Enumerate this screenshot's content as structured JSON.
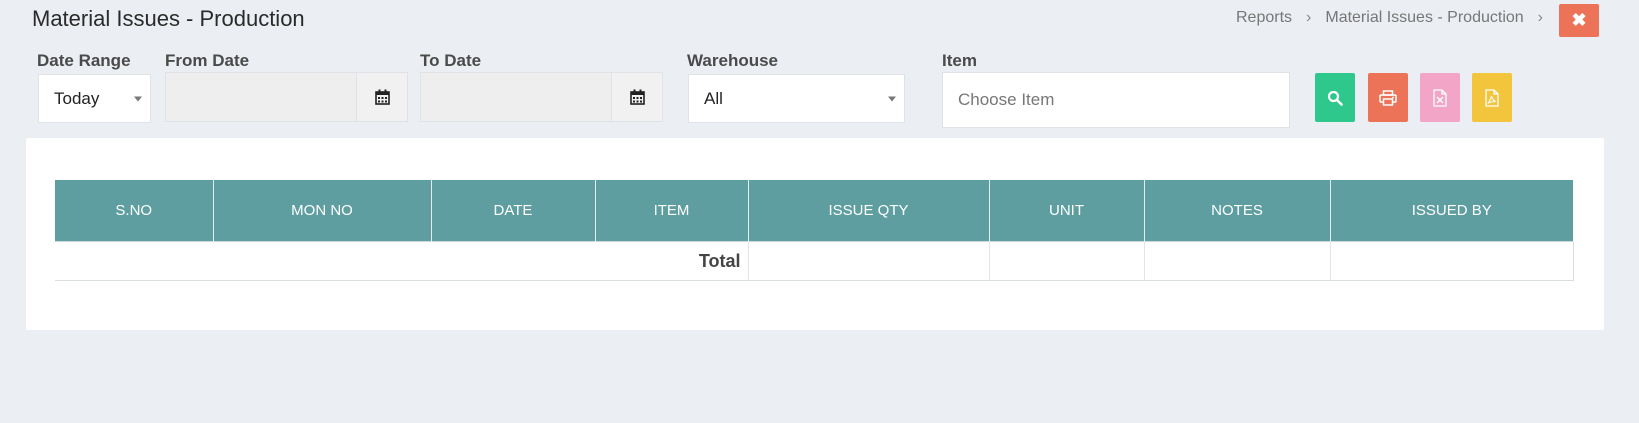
{
  "header": {
    "title": "Material Issues - Production",
    "breadcrumb": [
      "Reports",
      "Material Issues - Production"
    ],
    "close_icon": "close-icon"
  },
  "filters": {
    "date_range": {
      "label": "Date Range",
      "value": "Today"
    },
    "from_date": {
      "label": "From Date",
      "value": ""
    },
    "to_date": {
      "label": "To Date",
      "value": ""
    },
    "warehouse": {
      "label": "Warehouse",
      "value": "All"
    },
    "item": {
      "label": "Item",
      "placeholder": "Choose Item"
    }
  },
  "actions": [
    {
      "name": "search",
      "icon": "search-icon",
      "color": "#2ec88d"
    },
    {
      "name": "print",
      "icon": "print-icon",
      "color": "#ec7357"
    },
    {
      "name": "excel",
      "icon": "excel-file-icon",
      "color": "#f3a5c8"
    },
    {
      "name": "pdf",
      "icon": "pdf-file-icon",
      "color": "#f2c53d"
    }
  ],
  "table": {
    "columns": [
      "S.NO",
      "MON NO",
      "DATE",
      "ITEM",
      "ISSUE QTY",
      "UNIT",
      "NOTES",
      "ISSUED BY"
    ],
    "total_label": "Total"
  },
  "colors": {
    "header_bg": "#5f9ea0",
    "page_bg": "#ebeef3"
  }
}
